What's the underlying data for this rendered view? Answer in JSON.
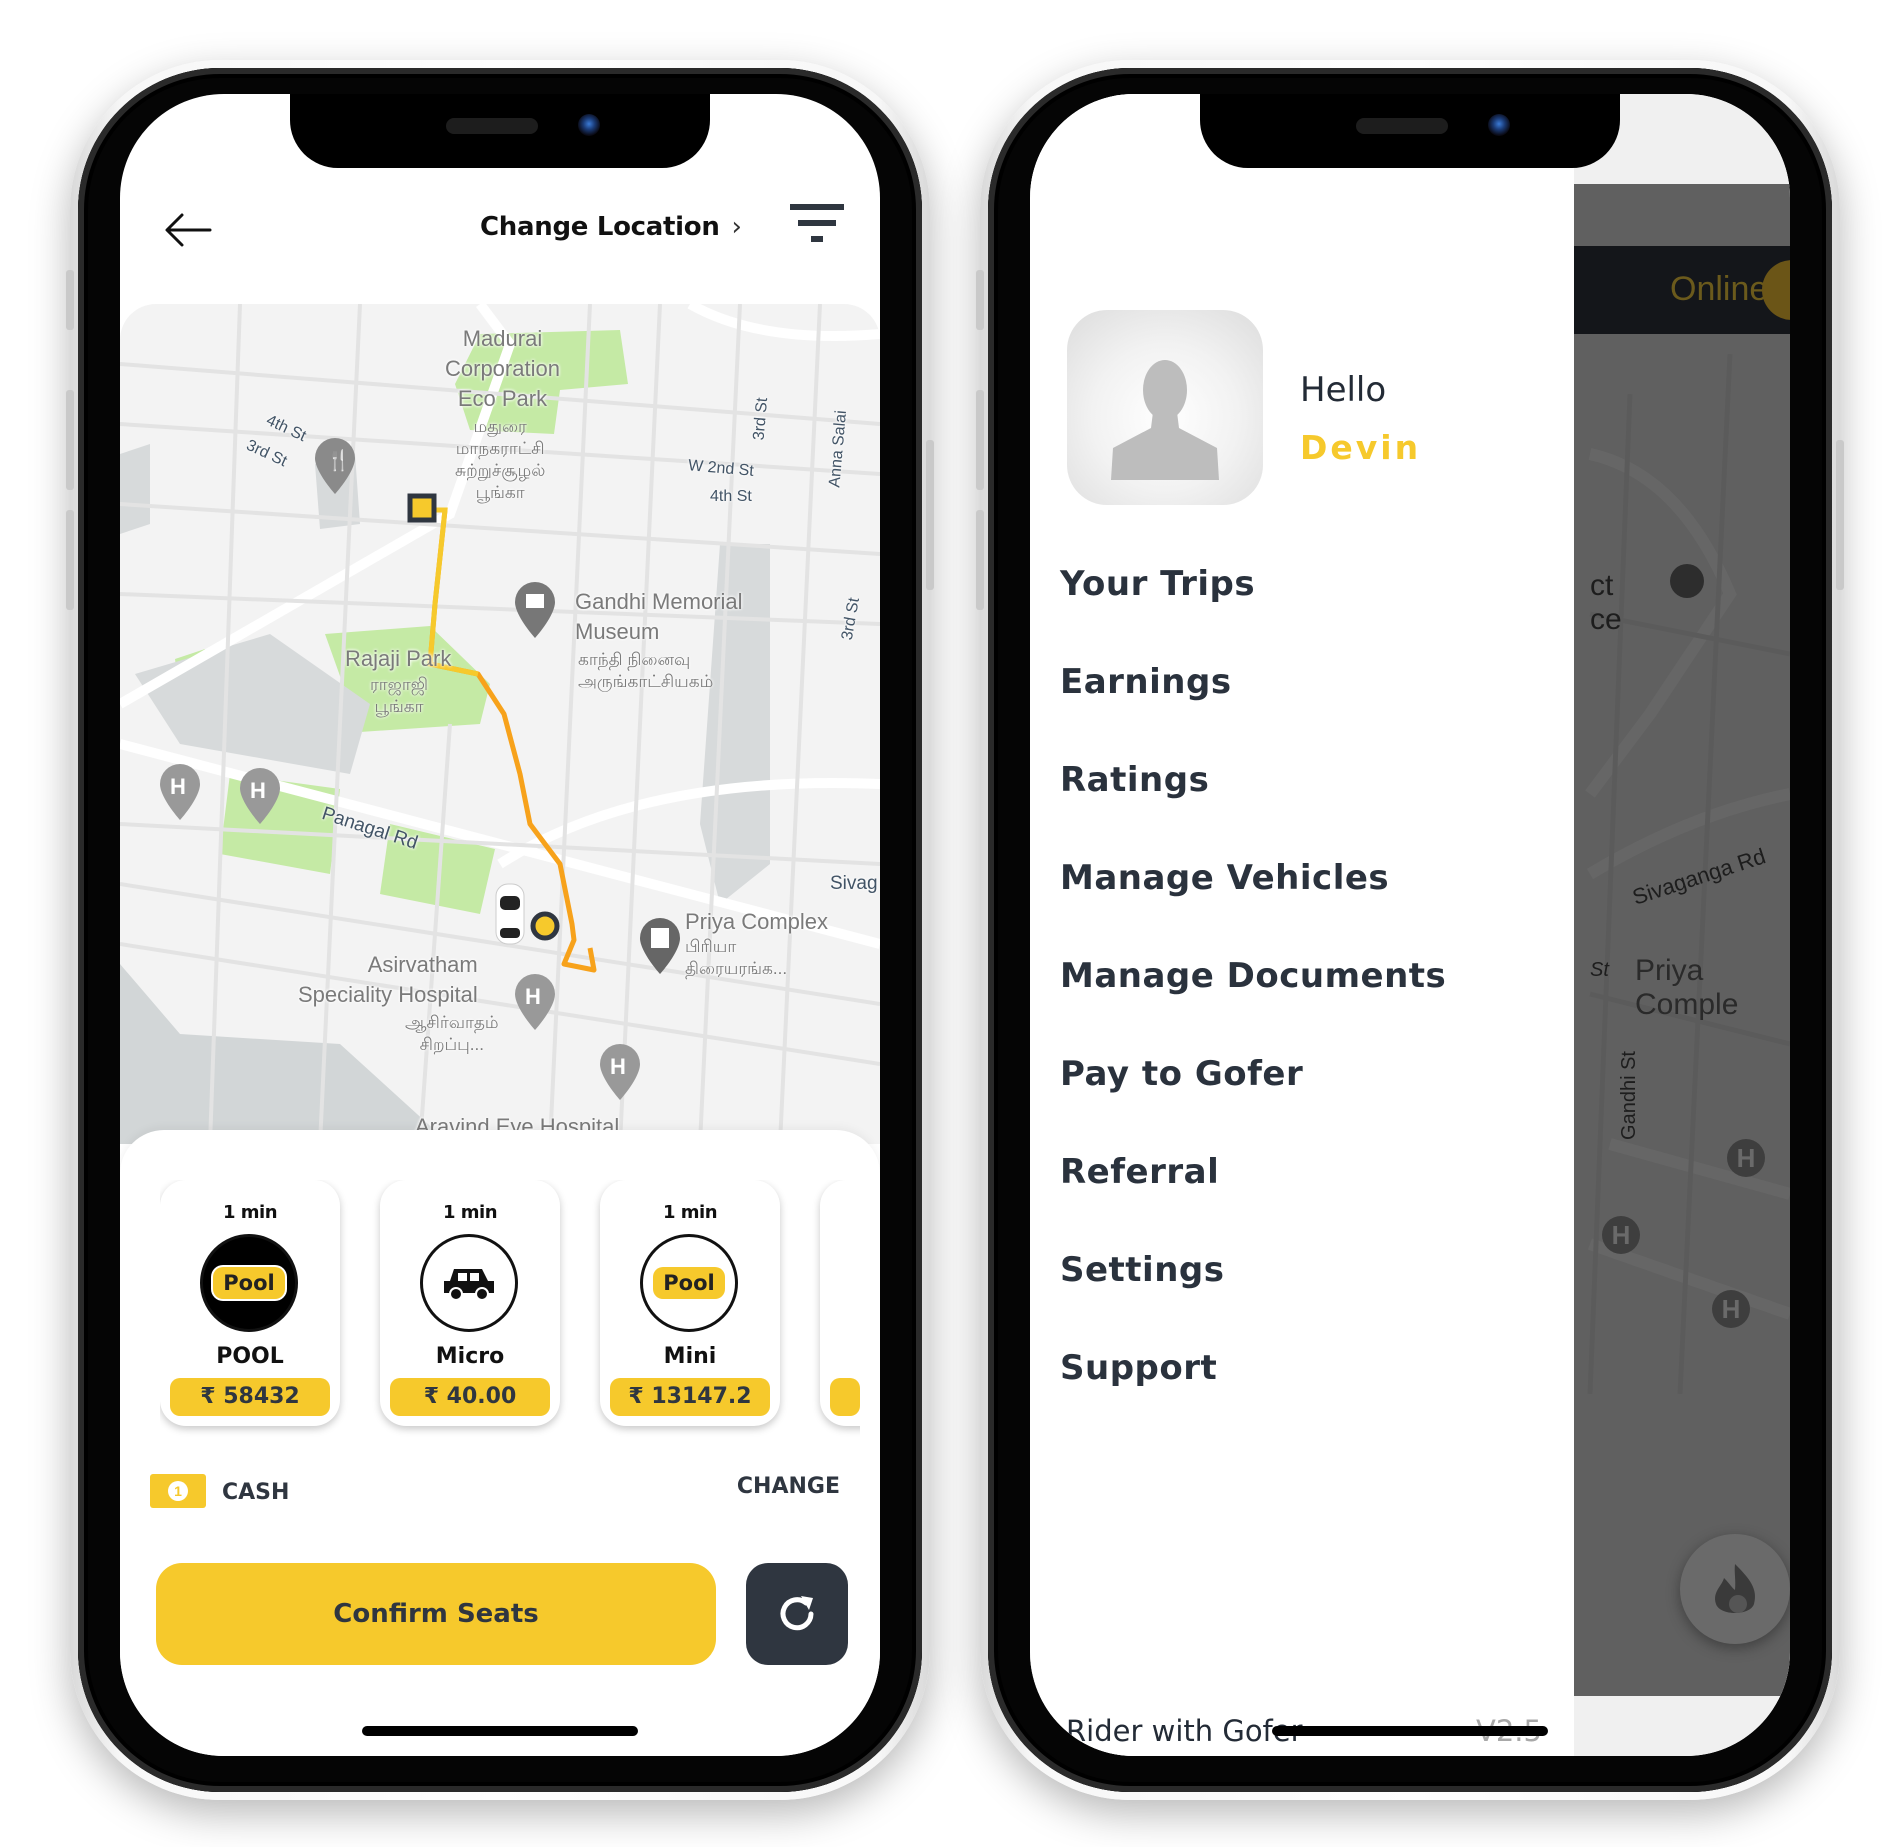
{
  "left_screen": {
    "header": {
      "back_icon": "arrow-left-icon",
      "title": "Change Location",
      "title_chevron": "›",
      "filter_icon": "filter-icon"
    },
    "map": {
      "labels": {
        "eco_park": "Madurai\nCorporation\nEco Park",
        "eco_park_tamil": "மதுரை\nமாநகராட்சி\nசுற்றுச்சூழல்\nபூங்கா",
        "fourth_st": "4th St",
        "third_st": "3rd St",
        "third_st_2": "3rd St",
        "w_2nd_st": "W 2nd St",
        "fourth_st_2": "4th St",
        "anna_salai": "Anna Salai",
        "third_st_3": "3rd St",
        "gandhi_museum": "Gandhi Memorial\nMuseum",
        "gandhi_museum_tamil": "காந்தி நினைவு\nஅருங்காட்சியகம்",
        "rajaji_park": "Rajaji Park",
        "rajaji_park_tamil": "ராஜாஜி\nபூங்கா",
        "panagal_rd": "Panagal Rd",
        "sivaganga": "Sivag",
        "priya_complex": "Priya Complex",
        "priya_complex_tamil": "பிரியா\nதிரையரங்க...",
        "asirvatham": "Asirvatham\nSpeciality Hospital",
        "asirvatham_tamil": "ஆசிர்வாதம்\nசிறப்பு...",
        "aravind": "Aravind Eye Hospital"
      },
      "route_color_start": "#f6c92c",
      "route_color_end": "#f7a21b"
    },
    "vehicles": [
      {
        "eta": "1 min",
        "icon": "pool-badge",
        "badge": "Pool",
        "name": "POOL",
        "price": "₹ 58432",
        "selected": true
      },
      {
        "eta": "1 min",
        "icon": "car-icon",
        "badge": "",
        "name": "Micro",
        "price": "₹ 40.00",
        "selected": false
      },
      {
        "eta": "1 min",
        "icon": "pool-badge",
        "badge": "Pool",
        "name": "Mini",
        "price": "₹ 13147.2",
        "selected": false
      }
    ],
    "payment": {
      "icon": "cash-icon",
      "coin": "1",
      "method": "CASH",
      "change_label": "CHANGE"
    },
    "confirm_label": "Confirm Seats",
    "refresh_icon": "refresh-icon"
  },
  "right_screen": {
    "status_label": "Online",
    "drawer": {
      "greeting": "Hello",
      "user_name": "Devin",
      "menu": [
        {
          "label": "Your Trips"
        },
        {
          "label": "Earnings"
        },
        {
          "label": "Ratings"
        },
        {
          "label": "Manage Vehicles"
        },
        {
          "label": "Manage Documents"
        },
        {
          "label": "Pay to Gofer"
        },
        {
          "label": "Referral"
        },
        {
          "label": "Settings"
        },
        {
          "label": "Support"
        }
      ],
      "footer_label": "Rider with Gofer",
      "version": "V2.5"
    },
    "map_labels": {
      "district": "ct\nce",
      "sivaganga_rd": "Sivaganga Rd",
      "priya_complex": "Priya Comple",
      "gandhi_st": "Gandhi St",
      "st": "St"
    }
  },
  "colors": {
    "accent_yellow": "#f6c92c",
    "dark_slate": "#2f3640",
    "route_orange": "#f7a21b"
  }
}
